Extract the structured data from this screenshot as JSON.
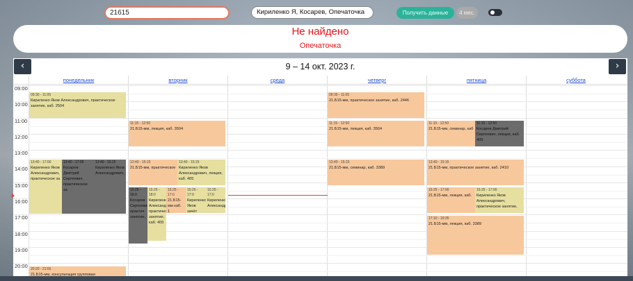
{
  "toolbar": {
    "search_value": "21615",
    "names_value": "Кириленко Я, Косарев, Опечаточка",
    "get_data_label": "Получить данные",
    "month_label": "4 мес."
  },
  "message": {
    "title": "Не найдено",
    "subtitle": "Опечаточка"
  },
  "calendar": {
    "prev_icon": "‹",
    "next_icon": "›",
    "range": "9 – 14 окт. 2023 г.",
    "days": [
      "понедельник",
      "вторник",
      "среда",
      "четверг",
      "пятница",
      "суббота"
    ],
    "hours": [
      "09:00",
      "10:00",
      "11:00",
      "12:00",
      "13:00",
      "14:00",
      "15:00",
      "16:00",
      "17:00",
      "18:00",
      "19:00",
      "20:00"
    ],
    "events": [
      {
        "time": "09:30 - 11:05",
        "text": "Кириленко Яков Александрович, практическое занятие, каб. 2504"
      },
      {
        "time": "13:40 - 17:00",
        "text": "Кириленко Яков Александрович, практическое за"
      },
      {
        "time": "13:40 - 17:00",
        "text": "Косарев Дмитрий Сергеевич, практическое за"
      },
      {
        "time": "13:40 - 15:15",
        "text": "Кириленко Яков Александрович,"
      },
      {
        "time": "20:20 - 21:55",
        "text": "21.Б15-мм, консультация групповая"
      },
      {
        "time": "11:15 - 12:50",
        "text": "21.Б15-мм, лекция, каб. 3504"
      },
      {
        "time": "13:40 - 15:15",
        "text": "21.Б15-мм, практическое"
      },
      {
        "time": "13:40 - 15:15",
        "text": "Кириленко Яков Александрович, лекция, каб. 405"
      },
      {
        "time": "15:25 - 18:0",
        "text": "Косарев Сергеевич практич занятие,"
      },
      {
        "time": "15:25 - 18:0",
        "text": "Кириленко Александр практичес занятие, каб. 405"
      },
      {
        "time": "15:25 - 17:0",
        "text": "21.Б15-мм каб. 1"
      },
      {
        "time": "15:25 - 17:0",
        "text": "Кириленко Яков зачёт (кон"
      },
      {
        "time": "15:25 - 17:0",
        "text": "Кириленко Александр"
      },
      {
        "time": "09:30 - 11:05",
        "text": "21.Б15-мм, практическое занятие, каб. 2446"
      },
      {
        "time": "11:15 - 12:50",
        "text": "21.Б15-мм, лекция, каб. 3504"
      },
      {
        "time": "13:40 - 15:15",
        "text": "21.Б15-мм, семинар, каб. 3389"
      },
      {
        "time": "11:15 - 12:50",
        "text": "21.Б15-мм, семинар, каб"
      },
      {
        "time": "11:15 - 12:50",
        "text": "Косарев Дмитрий Сергеевич, лекция, каб. 405"
      },
      {
        "time": "13:40 - 15:15",
        "text": "21.Б15-мм, практическое занятие, каб. 2410"
      },
      {
        "time": "15:25 - 17:00",
        "text": "21.Б15-мм, лекция, каб."
      },
      {
        "time": "15:25 - 17:00",
        "text": "Кириленко Яков Александрович, практическое занятие,"
      },
      {
        "time": "17:10 - 19:35",
        "text": "21.Б15-мм, лекция, каб. 3389"
      }
    ]
  }
}
